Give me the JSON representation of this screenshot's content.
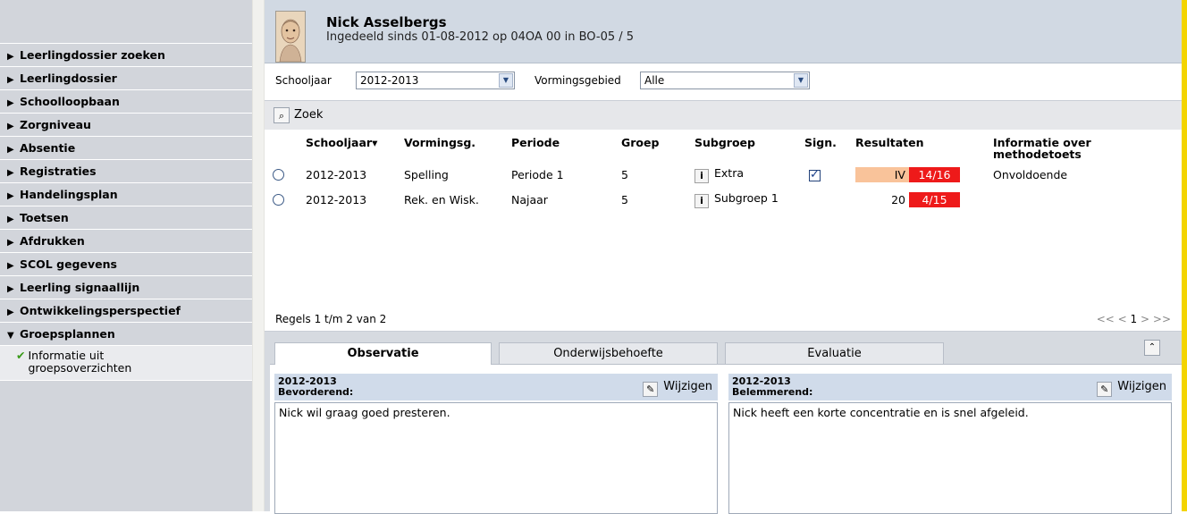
{
  "sidebar": {
    "items": [
      {
        "label": "Leerlingdossier zoeken"
      },
      {
        "label": "Leerlingdossier"
      },
      {
        "label": "Schoolloopbaan"
      },
      {
        "label": "Zorgniveau"
      },
      {
        "label": "Absentie"
      },
      {
        "label": "Registraties"
      },
      {
        "label": "Handelingsplan"
      },
      {
        "label": "Toetsen"
      },
      {
        "label": "Afdrukken"
      },
      {
        "label": "SCOL gegevens"
      },
      {
        "label": "Leerling signaallijn"
      },
      {
        "label": "Ontwikkelingsperspectief"
      },
      {
        "label": "Groepsplannen"
      }
    ],
    "open_item_subitem": "Informatie uit groepsoverzichten"
  },
  "header": {
    "name": "Nick Asselbergs",
    "info": "Ingedeeld sinds 01-08-2012 op 04OA 00 in BO-05 / 5"
  },
  "filters": {
    "schooljaar_label": "Schooljaar",
    "schooljaar_value": "2012-2013",
    "vormingsgebied_label": "Vormingsgebied",
    "vormingsgebied_value": "Alle"
  },
  "grid": {
    "search_label": "Zoek",
    "columns": [
      "Schooljaar▾",
      "Vormingsg.",
      "Periode",
      "Groep",
      "Subgroep",
      "Sign.",
      "Resultaten",
      "Informatie over methodetoets"
    ],
    "rows": [
      {
        "schooljaar": "2012-2013",
        "vormingsg": "Spelling",
        "periode": "Periode 1",
        "groep": "5",
        "subgroep": "Extra",
        "sign": true,
        "result_main": "IV",
        "result_score": "14/16",
        "info": "Onvoldoende"
      },
      {
        "schooljaar": "2012-2013",
        "vormingsg": "Rek. en Wisk.",
        "periode": "Najaar",
        "groep": "5",
        "subgroep": "Subgroep 1",
        "sign": false,
        "result_main": "20",
        "result_score": "4/15",
        "info": ""
      }
    ],
    "row_count": "Regels 1 t/m 2 van 2",
    "pager": {
      "first": "<<",
      "prev": "<",
      "page": "1",
      "next": ">",
      "last": ">>"
    }
  },
  "tabs": {
    "items": [
      "Observatie",
      "Onderwijsbehoefte",
      "Evaluatie"
    ],
    "active": "Observatie"
  },
  "observation": {
    "left": {
      "year": "2012-2013",
      "label": "Bevorderend:",
      "edit": "Wijzigen",
      "text": "Nick wil graag goed presteren."
    },
    "right": {
      "year": "2012-2013",
      "label": "Belemmerend:",
      "edit": "Wijzigen",
      "text": "Nick heeft een korte concentratie en is snel afgeleid."
    }
  },
  "colors": {
    "sidebar_bg": "#d2d5db",
    "header_bg": "#d1d9e3",
    "score_red": "#ee1a1a",
    "level_orange": "#f9c39a",
    "accent_yellow": "#f3d400",
    "check_green": "#3a9a1a"
  }
}
